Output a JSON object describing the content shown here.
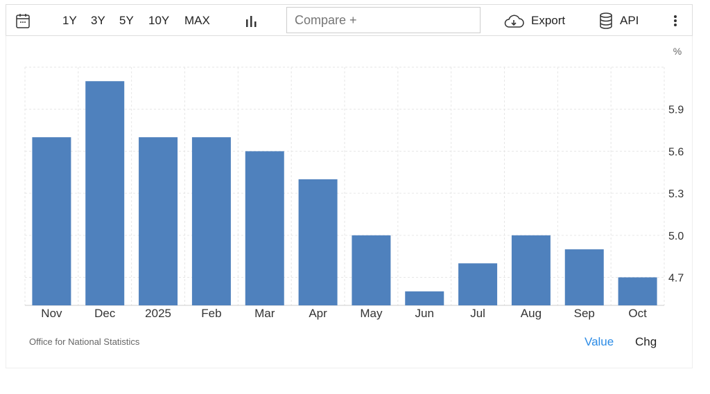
{
  "toolbar": {
    "ranges": [
      "1Y",
      "3Y",
      "5Y",
      "10Y",
      "MAX"
    ],
    "compare_placeholder": "Compare +",
    "export_label": "Export",
    "api_label": "API"
  },
  "footer": {
    "source": "Office for National Statistics",
    "value_tab": "Value",
    "chg_tab": "Chg"
  },
  "colors": {
    "bar": "#4f81bd",
    "active_tab": "#2b8be6"
  },
  "chart_data": {
    "type": "bar",
    "unit_label": "%",
    "categories": [
      "Nov",
      "Dec",
      "2025",
      "Feb",
      "Mar",
      "Apr",
      "May",
      "Jun",
      "Jul",
      "Aug",
      "Sep",
      "Oct"
    ],
    "values": [
      5.7,
      6.1,
      5.7,
      5.7,
      5.6,
      5.4,
      5.0,
      4.6,
      4.8,
      5.0,
      4.9,
      4.7
    ],
    "yticks": [
      "4.7",
      "5.0",
      "5.3",
      "5.6",
      "5.9"
    ],
    "ylim": [
      4.5,
      6.2
    ],
    "y_axis_side": "right",
    "grid": true
  }
}
